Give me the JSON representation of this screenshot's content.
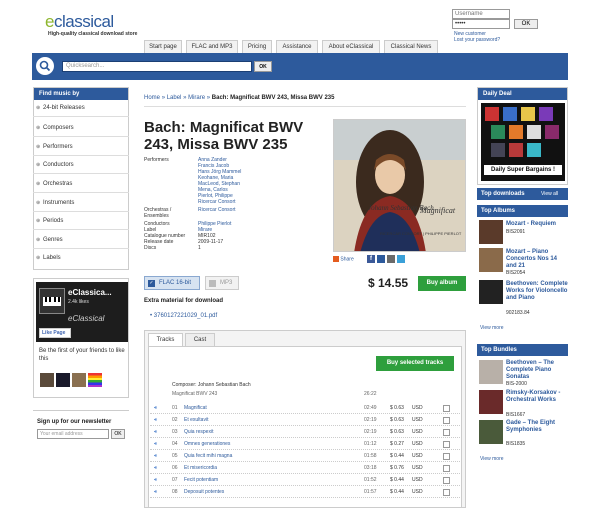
{
  "header": {
    "logo_main": "classical",
    "logo_e": "e",
    "tagline": "High-quality classical download store",
    "username_placeholder": "Username",
    "password_value": "•••••",
    "ok_label": "OK",
    "new_customer": "New customer",
    "lost_password": "Lost your password?"
  },
  "nav": {
    "tabs": [
      "Start page",
      "FLAC and MP3",
      "Pricing",
      "Assistance",
      "About eClassical",
      "Classical News"
    ]
  },
  "search": {
    "placeholder": "Quicksearch...",
    "ok_label": "OK"
  },
  "sidebar": {
    "header": "Find music by",
    "items": [
      "24-bit Releases",
      "Composers",
      "Performers",
      "Conductors",
      "Orchestras",
      "Instruments",
      "Periods",
      "Genres",
      "Labels"
    ]
  },
  "facebook": {
    "name": "eClassica...",
    "likes": "2.4k likes",
    "cover_text": "eClassical",
    "like_label": "Like Page",
    "friends_text": "Be the first of your friends to like this"
  },
  "newsletter": {
    "title": "Sign up for our newsletter",
    "placeholder": "Your email address",
    "ok_label": "OK"
  },
  "breadcrumb": {
    "items": [
      "Home",
      "Label",
      "Mirare"
    ],
    "current": "Bach: Magnificat BWV 243, Missa BWV 235",
    "sep": "»"
  },
  "album": {
    "title": "Bach: Magnificat BWV 243, Missa BWV 235",
    "performers_label": "Performers",
    "performers": [
      "Anna Zander",
      "Francis Jacob",
      "Hans Jörg Mammel",
      "Keohane, Maria",
      "MacLeod, Stephan",
      "Mena, Carlos",
      "Pierlot, Philippe",
      "Ricercar Consort"
    ],
    "orchestras_label": "Orchestras / Ensembles",
    "orchestras": "Ricercar Consort",
    "conductors_label": "Conductors",
    "conductors": "Philippe Pierlot",
    "label_label": "Label",
    "label": "Mirare",
    "catalogue_label": "Catalogue number",
    "catalogue": "MIR102",
    "release_label": "Release date",
    "release": "2009-11-17",
    "discs_label": "Discs",
    "discs": "1",
    "cover_line1": "Johann Sebastian Bach",
    "cover_line2": "Magnificat",
    "cover_line3": "RICERCAR CONSORT | PHILIPPE PIERLOT",
    "share_label": "Share",
    "format_flac": "FLAC 16-bit",
    "format_mp3": "MP3",
    "price": "$ 14.55",
    "buy_album": "Buy album",
    "extra_title": "Extra material for download",
    "extra_file": "3760127221029_01.pdf"
  },
  "tabs": {
    "items": [
      "Tracks",
      "Cast"
    ],
    "buy_selected": "Buy selected tracks"
  },
  "tracklist": {
    "composer": "Composer: Johann Sebastian Bach",
    "work": "Magnificat BWV 243",
    "work_duration": "26:22",
    "tracks": [
      {
        "no": "01",
        "title": "Magnificat",
        "dur": "02:49",
        "price": "$ 0.63",
        "cur": "USD"
      },
      {
        "no": "02",
        "title": "Et exultavit",
        "dur": "02:19",
        "price": "$ 0.63",
        "cur": "USD"
      },
      {
        "no": "03",
        "title": "Quia respexit",
        "dur": "02:19",
        "price": "$ 0.63",
        "cur": "USD"
      },
      {
        "no": "04",
        "title": "Omnes generationes",
        "dur": "01:12",
        "price": "$ 0.27",
        "cur": "USD"
      },
      {
        "no": "05",
        "title": "Quia fecit mihi magna",
        "dur": "01:58",
        "price": "$ 0.44",
        "cur": "USD"
      },
      {
        "no": "06",
        "title": "Et misericordia",
        "dur": "03:18",
        "price": "$ 0.76",
        "cur": "USD"
      },
      {
        "no": "07",
        "title": "Fecit potentiam",
        "dur": "01:52",
        "price": "$ 0.44",
        "cur": "USD"
      },
      {
        "no": "08",
        "title": "Deposuit potentes",
        "dur": "01:57",
        "price": "$ 0.44",
        "cur": "USD"
      }
    ]
  },
  "right": {
    "daily_deal": "Daily Deal",
    "daily_banner": "Daily Super Bargains !",
    "top_downloads": "Top downloads",
    "view_all": "View all",
    "top_albums": "Top Albums",
    "albums": [
      {
        "title": "Mozart - Requiem",
        "code": "BIS2091"
      },
      {
        "title": "Mozart – Piano Concertos Nos 14 and 21",
        "code": "BIS2054"
      },
      {
        "title": "Beethoven: Complete Works for Violoncello and Piano",
        "code": "902183.84"
      }
    ],
    "view_more": "View more",
    "top_bundles": "Top Bundles",
    "bundles": [
      {
        "title": "Beethoven – The Complete Piano Sonatas",
        "code": "BIS-2000"
      },
      {
        "title": "Rimsky-Korsakov - Orchestral Works",
        "code": "BIS1667"
      },
      {
        "title": "Gade – The Eight Symphonies",
        "code": "BIS1835"
      }
    ],
    "view_more2": "View more"
  }
}
